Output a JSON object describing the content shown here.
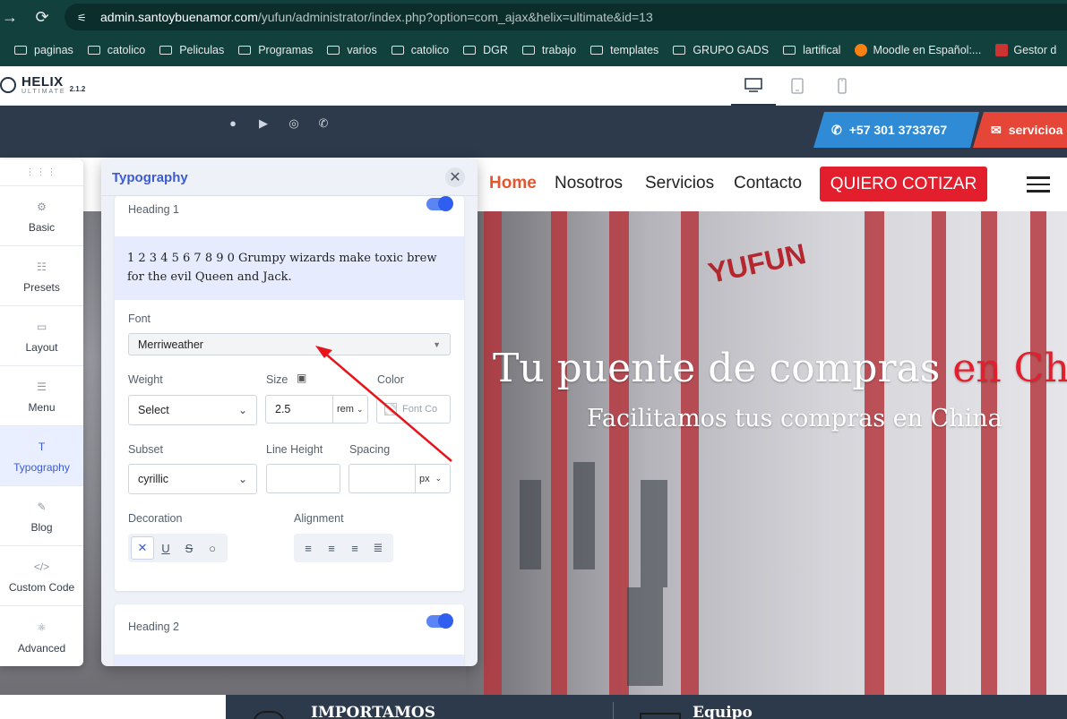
{
  "browser": {
    "url_host": "admin.santoybuenamor.com",
    "url_path": "/yufun/administrator/index.php?option=com_ajax&helix=ultimate&id=13",
    "bookmarks": [
      "paginas",
      "catolico",
      "Peliculas",
      "Programas",
      "varios",
      "catolico",
      "DGR",
      "trabajo",
      "templates",
      "GRUPO GADS",
      "lartifical",
      "Moodle en Español:...",
      "Gestor d"
    ]
  },
  "helix": {
    "logo_title": "HELIX",
    "logo_sub": "ULTIMATE",
    "version": "2.1.2"
  },
  "site": {
    "phone": "+57 301 3733767",
    "email": "servicioa",
    "nav": [
      "Home",
      "Nosotros",
      "Servicios",
      "Contacto"
    ],
    "cta": "QUIERO COTIZAR",
    "hero_title_a": "Tu puente de compras ",
    "hero_title_b": "en Chi",
    "hero_subtitle": "Facilitamos tus compras en China",
    "sign": "YUFUN",
    "band_left": "IMPORTAMOS",
    "band_right": "Equipo"
  },
  "sidebar": {
    "items": [
      "Basic",
      "Presets",
      "Layout",
      "Menu",
      "Typography",
      "Blog",
      "Custom Code",
      "Advanced"
    ]
  },
  "panel": {
    "title": "Typography",
    "heading1": "Heading 1",
    "heading2": "Heading 2",
    "preview": "1 2 3 4 5 6 7 8 9 0 Grumpy wizards make toxic brew for the evil Queen and Jack.",
    "font_label": "Font",
    "font_value": "Merriweather",
    "weight_label": "Weight",
    "weight_value": "Select",
    "size_label": "Size",
    "size_value": "2.5",
    "size_unit": "rem",
    "color_label": "Color",
    "color_placeholder": "Font Co",
    "subset_label": "Subset",
    "subset_value": "cyrillic",
    "lineheight_label": "Line Height",
    "spacing_label": "Spacing",
    "spacing_unit": "px",
    "decoration_label": "Decoration",
    "alignment_label": "Alignment"
  },
  "colors": {
    "accent": "#3c5bd3",
    "cta": "#e31f2e",
    "nav_active": "#e4572e",
    "topbar": "#2c3a4b",
    "annotation_arrow": "#e8141c"
  }
}
